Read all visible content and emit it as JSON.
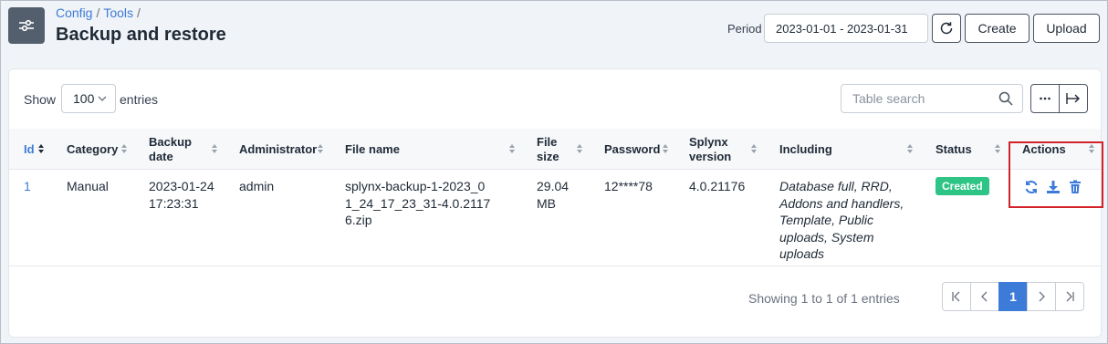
{
  "breadcrumb": {
    "item1": "Config",
    "item2": "Tools",
    "separator": "/"
  },
  "page_title": "Backup and restore",
  "toolbar": {
    "period_label": "Period",
    "period_value": "2023-01-01 - 2023-01-31",
    "refresh_icon": "refresh-icon",
    "create_label": "Create",
    "upload_label": "Upload"
  },
  "table_controls": {
    "show_label": "Show",
    "page_size": "100",
    "entries_label": "entries",
    "search_placeholder": "Table search"
  },
  "table": {
    "columns": [
      {
        "label": "Id",
        "active": true
      },
      {
        "label": "Category"
      },
      {
        "label": "Backup date"
      },
      {
        "label": "Administrator"
      },
      {
        "label": "File name"
      },
      {
        "label": "File size"
      },
      {
        "label": "Password"
      },
      {
        "label": "Splynx version"
      },
      {
        "label": "Including"
      },
      {
        "label": "Status"
      },
      {
        "label": "Actions"
      }
    ],
    "rows": [
      {
        "id": "1",
        "category": "Manual",
        "backup_date": "2023-01-24 17:23:31",
        "administrator": "admin",
        "file_name": "splynx-backup-1-2023_01_24_17_23_31-4.0.21176.zip",
        "file_size": "29.04 MB",
        "password": "12****78",
        "version": "4.0.21176",
        "including": "Database full, RRD, Addons and handlers, Template, Public uploads, System uploads",
        "status": "Created",
        "actions": [
          "restore-icon",
          "download-icon",
          "delete-icon"
        ]
      }
    ]
  },
  "pagination": {
    "info": "Showing 1 to 1 of 1 entries",
    "current_page": "1"
  },
  "colors": {
    "accent": "#3d7bd9",
    "status_created": "#2ec486",
    "highlight": "#d2232a",
    "app_icon_bg": "#545f6e"
  }
}
